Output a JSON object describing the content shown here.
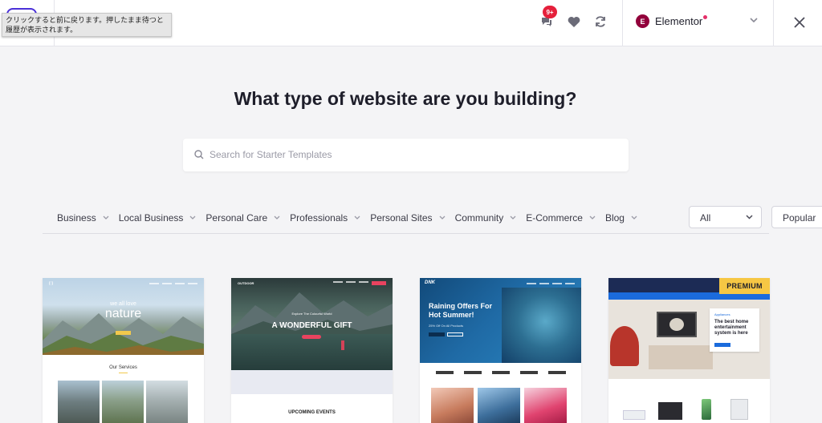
{
  "header": {
    "tooltip": "クリックすると前に戻ります。押したまま待つと履歴が表示されます。",
    "notification_badge": "9+",
    "builder": {
      "name": "Elementor",
      "logo_letter": "E"
    }
  },
  "main": {
    "title": "What type of website are you building?",
    "search": {
      "placeholder": "Search for Starter Templates",
      "value": ""
    }
  },
  "categories": [
    "Business",
    "Local Business",
    "Personal Care",
    "Professionals",
    "Personal Sites",
    "Community",
    "E-Commerce",
    "Blog"
  ],
  "filters": {
    "type_selected": "All",
    "sort_selected": "Popular"
  },
  "cards": [
    {
      "hero_sub": "we all love",
      "hero_title": "nature",
      "section_title": "Our Services"
    },
    {
      "logo": "OUTDOOR",
      "kicker": "Explore The Colourful World",
      "hero_title": "A WONDERFUL GIFT",
      "section_title": "UPCOMING EVENTS"
    },
    {
      "logo": "DNK",
      "hero_title": "Raining Offers For Hot Summer!",
      "hero_sub": "25% Off On All Products"
    },
    {
      "badge": "PREMIUM",
      "panel_label": "Appliances",
      "panel_title": "The best home entertainment system is here"
    }
  ],
  "colors": {
    "accent": "#4a30d8",
    "elementor": "#92003b",
    "badge_red": "#e5203b",
    "premium": "#f6c744"
  }
}
